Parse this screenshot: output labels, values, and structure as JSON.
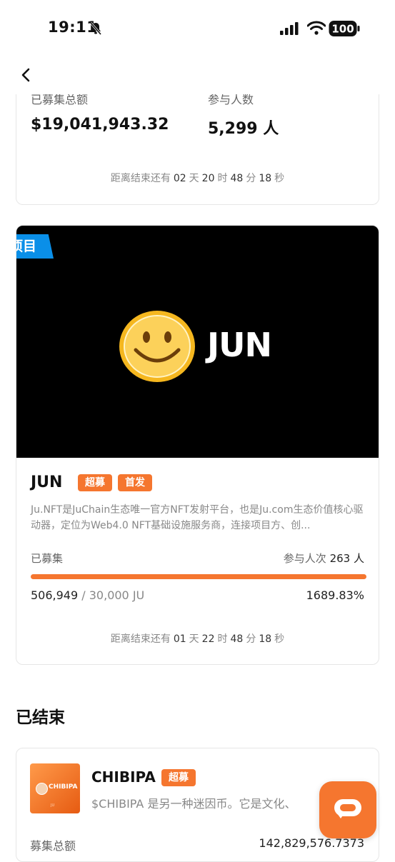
{
  "status": {
    "time": "19:11",
    "battery": "100"
  },
  "top_card": {
    "total_label": "已募集总额",
    "total_value": "$19,041,943.32",
    "people_label": "参与人数",
    "people_value": "5,299 人",
    "countdown": {
      "prefix": "距离结束还有",
      "days": "02",
      "days_unit": "天",
      "hours": "20",
      "hours_unit": "时",
      "minutes": "48",
      "minutes_unit": "分",
      "seconds": "18",
      "seconds_unit": "秒"
    }
  },
  "project": {
    "ribbon": "项目",
    "banner_title": "JUN",
    "name": "JUN",
    "tags": [
      "超募",
      "首发"
    ],
    "description": "Ju.NFT是JuChain生态唯一官方NFT发射平台，也是Ju.com生态价值核心驱动器，定位为Web4.0 NFT基础设施服务商，连接项目方、创...",
    "raised_label": "已募集",
    "participants_label": "参与人次",
    "participants_value": "263 人",
    "progress_percent": 100,
    "raised_amount": "506,949",
    "goal_text": "/ 30,000 JU",
    "percent_text": "1689.83%",
    "countdown": {
      "prefix": "距离结束还有",
      "days": "01",
      "days_unit": "天",
      "hours": "22",
      "hours_unit": "时",
      "minutes": "48",
      "minutes_unit": "分",
      "seconds": "18",
      "seconds_unit": "秒"
    }
  },
  "ended_section": {
    "title": "已结束"
  },
  "ended_card": {
    "thumb_text": "CHIBIPA",
    "thumb_sub": "JU",
    "name": "CHIBIPA",
    "tag": "超募",
    "description": "$CHIBIPA 是另一种迷因币。它是文化、",
    "total_label": "募集总额",
    "total_value": "142,829,576.7373"
  },
  "colors": {
    "accent": "#f5762f",
    "ribbon": "#0a8fe8",
    "banner_bg": "#000000"
  },
  "icons": [
    "back-arrow-icon",
    "bell-muted-icon",
    "signal-icon",
    "wifi-icon",
    "battery-icon",
    "smiley-icon",
    "chat-icon"
  ]
}
